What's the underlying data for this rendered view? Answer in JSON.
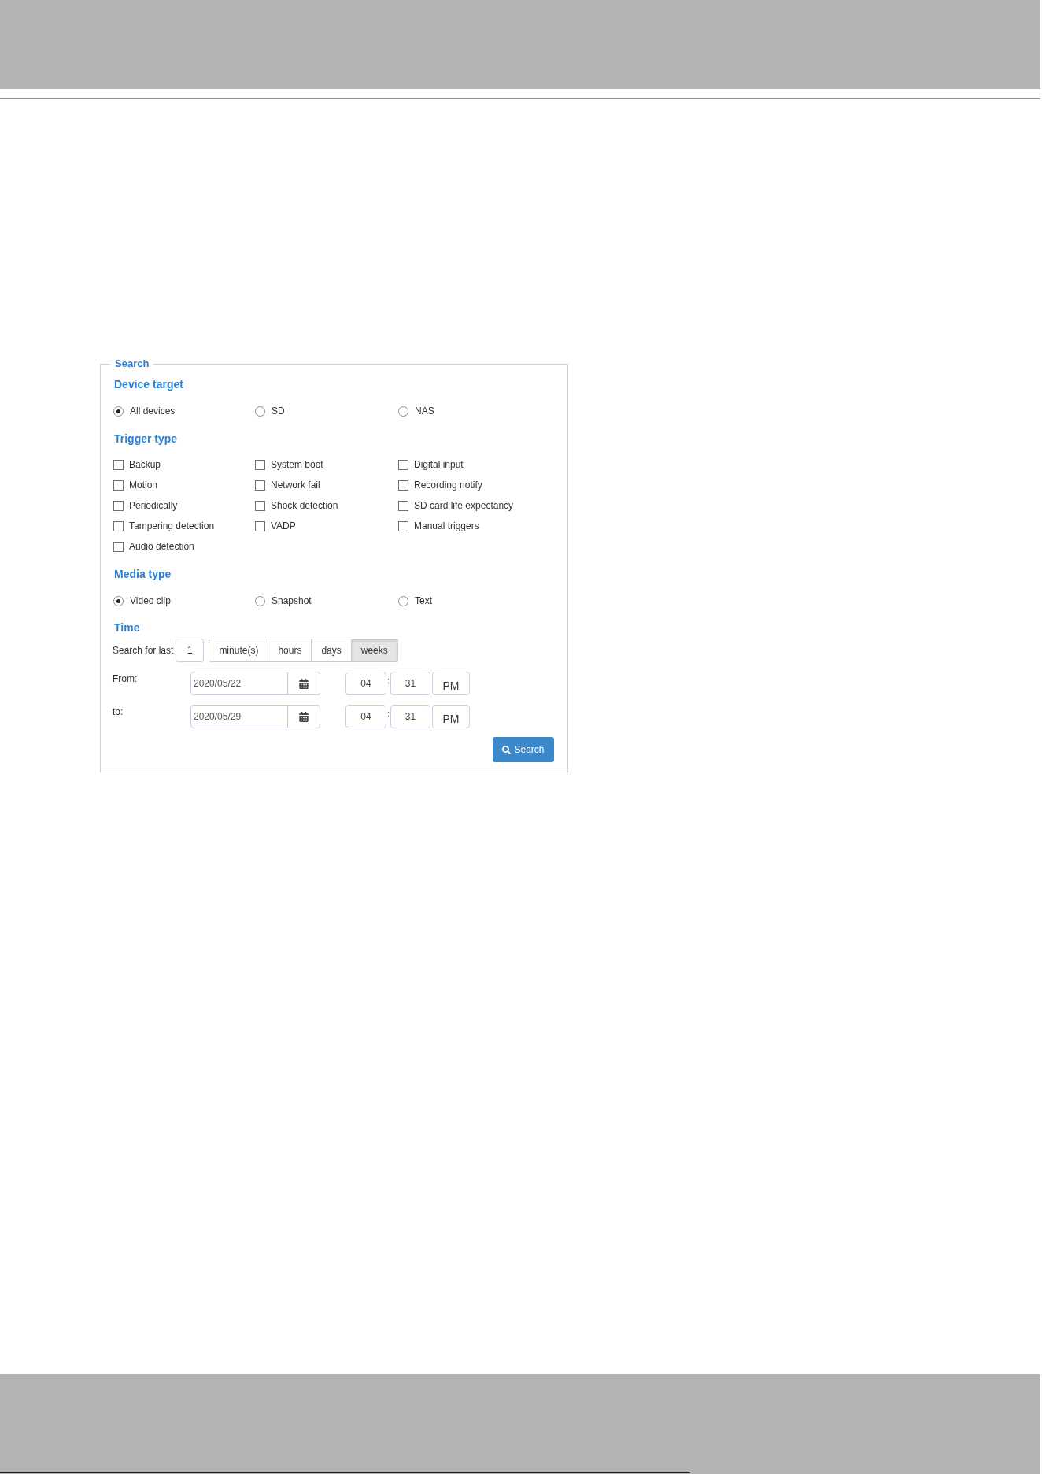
{
  "search_panel": {
    "legend": "Search",
    "sections": [
      {
        "kind": "radio",
        "heading": "Device target",
        "options": [
          {
            "label": "All devices",
            "selected": true
          },
          {
            "label": "SD",
            "selected": false
          },
          {
            "label": "NAS",
            "selected": false
          }
        ]
      },
      {
        "kind": "checkbox",
        "heading": "Trigger type",
        "options": [
          {
            "label": "Backup",
            "checked": false
          },
          {
            "label": "System boot",
            "checked": false
          },
          {
            "label": "Digital input",
            "checked": false
          },
          {
            "label": "Motion",
            "checked": false
          },
          {
            "label": "Network fail",
            "checked": false
          },
          {
            "label": "Recording notify",
            "checked": false
          },
          {
            "label": "Periodically",
            "checked": false
          },
          {
            "label": "Shock detection",
            "checked": false
          },
          {
            "label": "SD card life expectancy",
            "checked": false
          },
          {
            "label": "Tampering detection",
            "checked": false
          },
          {
            "label": "VADP",
            "checked": false
          },
          {
            "label": "Manual triggers",
            "checked": false
          },
          {
            "label": "Audio detection",
            "checked": false
          }
        ]
      },
      {
        "kind": "radio",
        "heading": "Media type",
        "options": [
          {
            "label": "Video clip",
            "selected": true
          },
          {
            "label": "Snapshot",
            "selected": false
          },
          {
            "label": "Text",
            "selected": false
          }
        ]
      }
    ],
    "time": {
      "heading": "Time",
      "last_label": "Search for last",
      "last_value": "1",
      "units": [
        {
          "label": "minute(s)",
          "selected": false
        },
        {
          "label": "hours",
          "selected": false
        },
        {
          "label": "days",
          "selected": false
        },
        {
          "label": "weeks",
          "selected": true
        }
      ],
      "range": [
        {
          "label": "From:",
          "date": "2020/05/22",
          "hour": "04",
          "separator": ":",
          "minute": "31",
          "meridiem": "PM"
        },
        {
          "label": "to:",
          "date": "2020/05/29",
          "hour": "04",
          "separator": ":",
          "minute": "31",
          "meridiem": "PM"
        }
      ]
    },
    "search_button": {
      "label": "Search"
    }
  }
}
